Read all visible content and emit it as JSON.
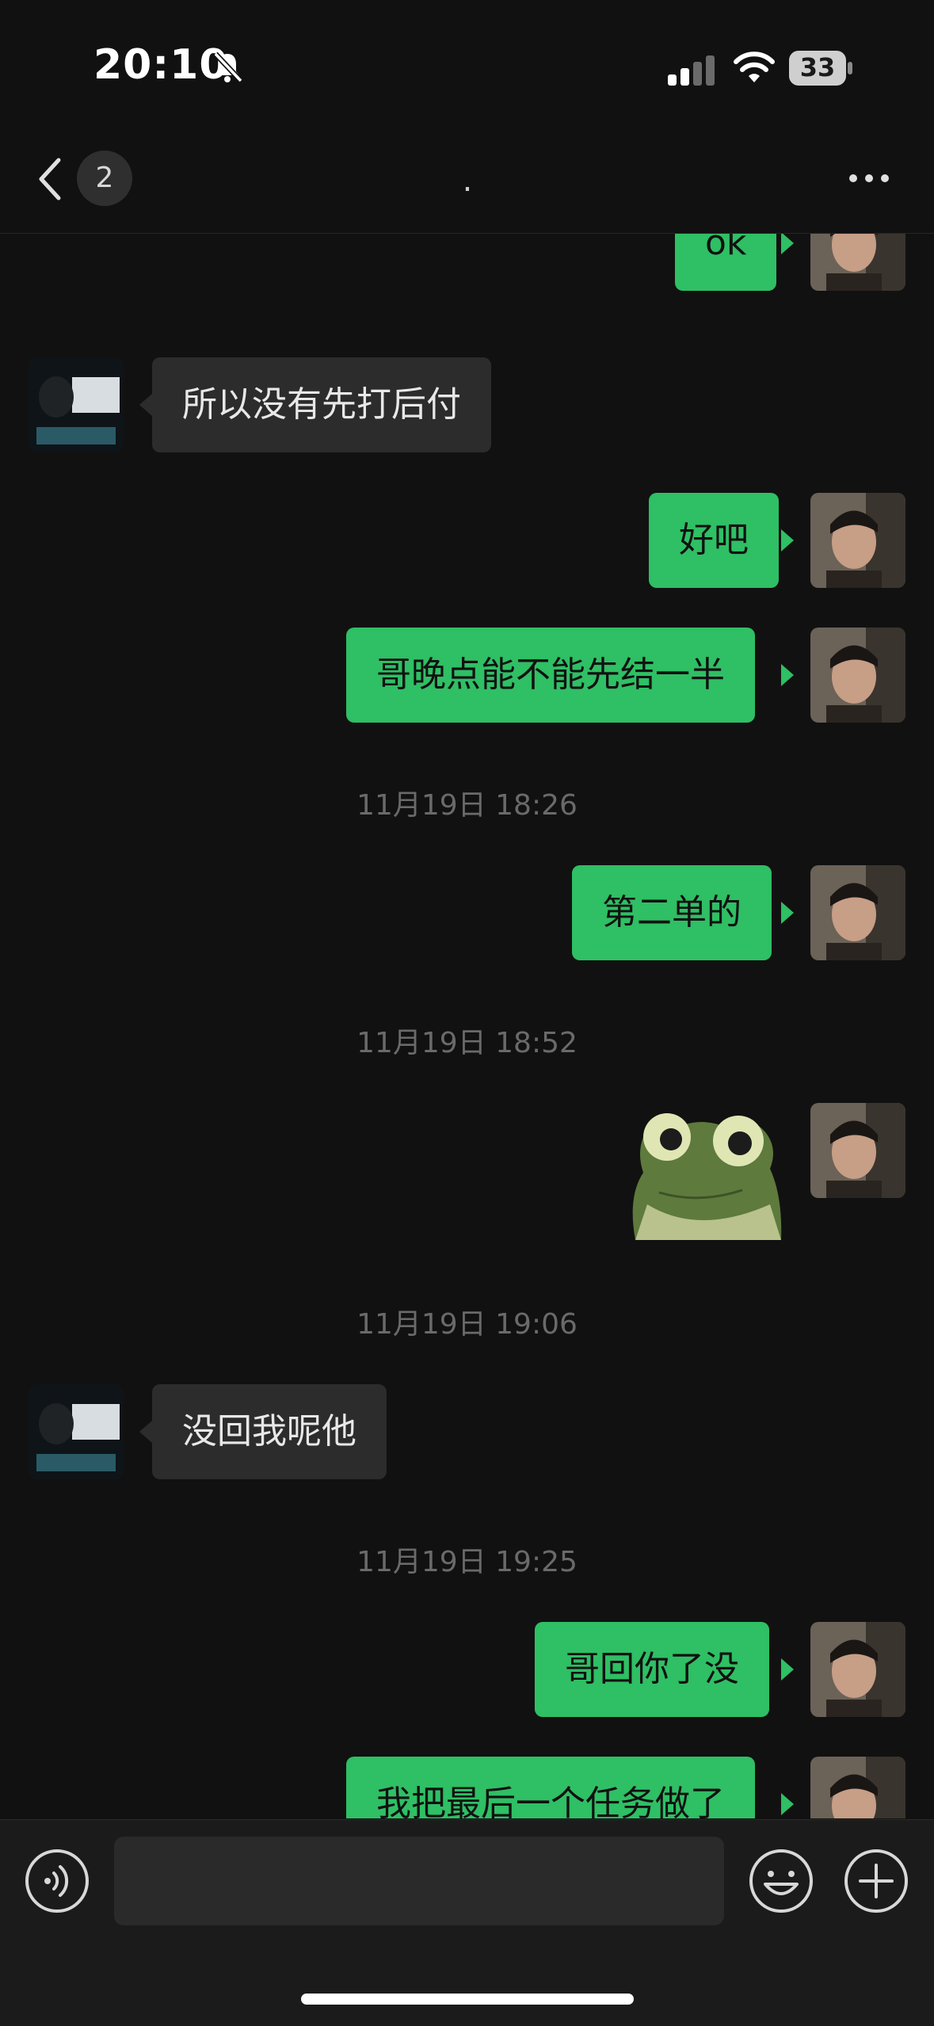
{
  "status_bar": {
    "time": "20:10",
    "battery": "33"
  },
  "nav": {
    "unread_count": "2",
    "title": "."
  },
  "messages": [
    {
      "type": "text",
      "from": "me",
      "text": "ok"
    },
    {
      "type": "text",
      "from": "other",
      "text": "所以没有先打后付"
    },
    {
      "type": "text",
      "from": "me",
      "text": "好吧"
    },
    {
      "type": "text",
      "from": "me",
      "text": "哥晚点能不能先结一半"
    },
    {
      "type": "timestamp",
      "text": "11月19日 18:26"
    },
    {
      "type": "text",
      "from": "me",
      "text": "第二单的"
    },
    {
      "type": "timestamp",
      "text": "11月19日 18:52"
    },
    {
      "type": "sticker",
      "from": "me",
      "icon": "frog-sticker"
    },
    {
      "type": "timestamp",
      "text": "11月19日 19:06"
    },
    {
      "type": "text",
      "from": "other",
      "text": "没回我呢他"
    },
    {
      "type": "timestamp",
      "text": "11月19日 19:25"
    },
    {
      "type": "text",
      "from": "me",
      "text": "哥回你了没"
    },
    {
      "type": "text",
      "from": "me",
      "text": "我把最后一个任务做了"
    }
  ],
  "input": {
    "value": "",
    "placeholder": ""
  },
  "colors": {
    "my_bubble": "#2fbf64",
    "other_bubble": "#2c2c2c",
    "background": "#111111"
  }
}
